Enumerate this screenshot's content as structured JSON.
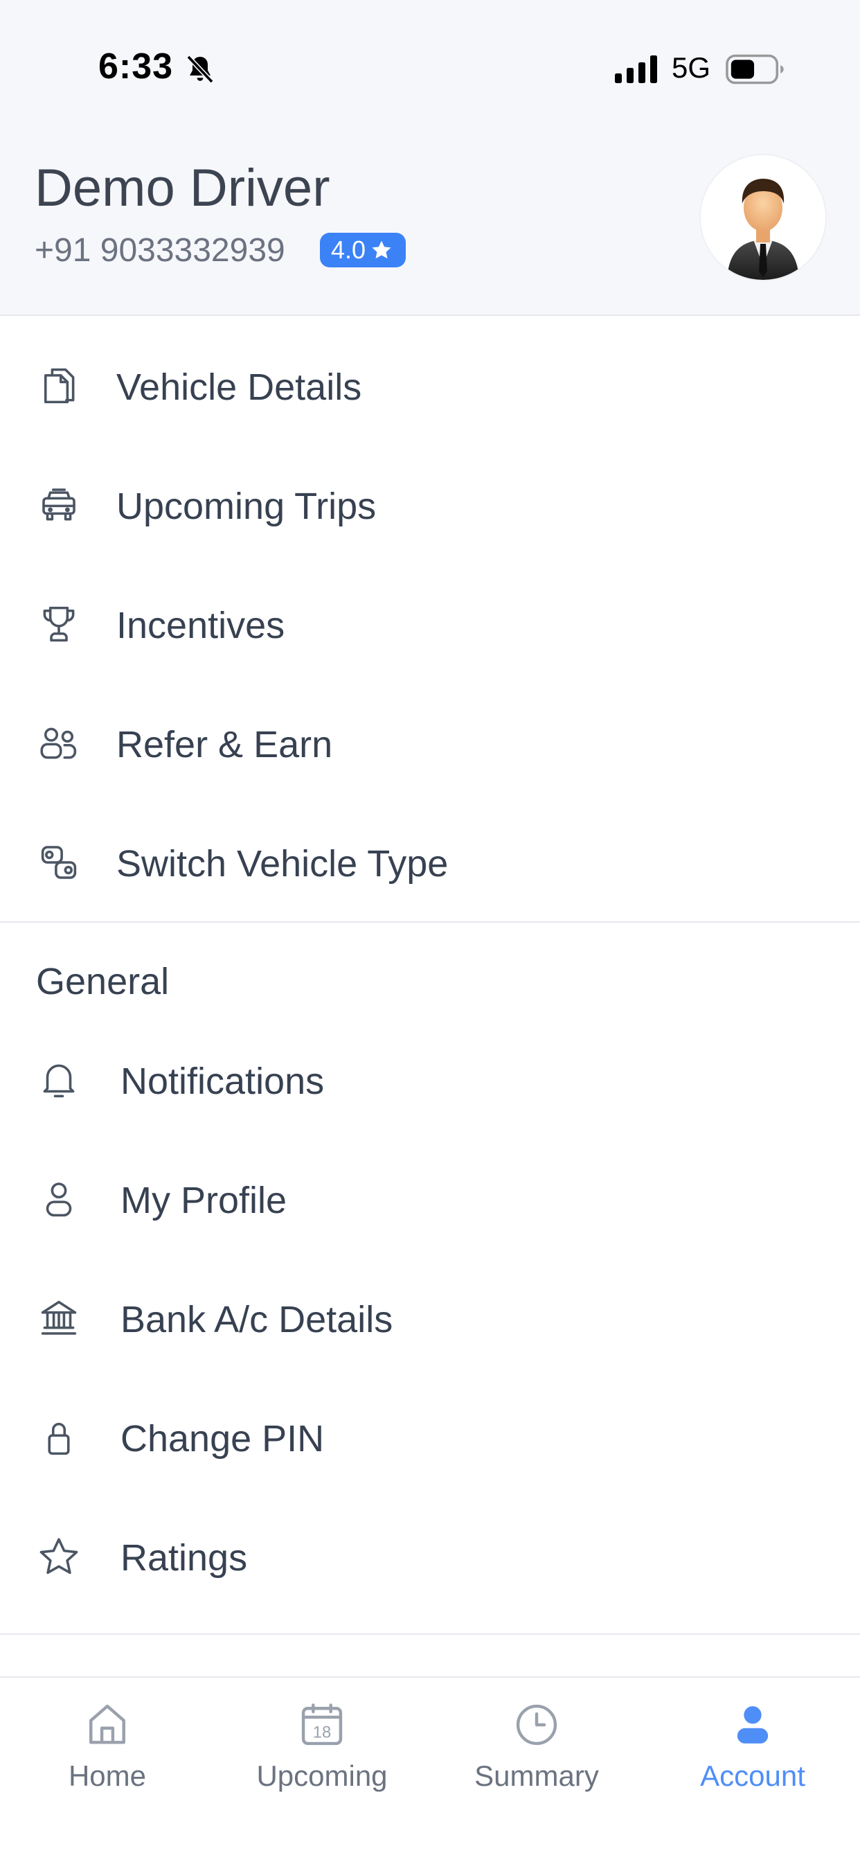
{
  "status_bar": {
    "time": "6:33",
    "network": "5G"
  },
  "profile": {
    "name": "Demo Driver",
    "phone": "+91 9033332939",
    "rating": "4.0"
  },
  "menu_primary": [
    {
      "label": "Vehicle Details",
      "icon": "document-icon"
    },
    {
      "label": "Upcoming Trips",
      "icon": "taxi-icon"
    },
    {
      "label": "Incentives",
      "icon": "trophy-icon"
    },
    {
      "label": "Refer & Earn",
      "icon": "users-icon"
    },
    {
      "label": "Switch Vehicle Type",
      "icon": "switch-icon"
    }
  ],
  "general": {
    "title": "General",
    "items": [
      {
        "label": "Notifications",
        "icon": "bell-icon"
      },
      {
        "label": "My Profile",
        "icon": "user-icon"
      },
      {
        "label": "Bank A/c Details",
        "icon": "bank-icon"
      },
      {
        "label": "Change PIN",
        "icon": "lock-icon"
      },
      {
        "label": "Ratings",
        "icon": "star-icon"
      }
    ]
  },
  "tabs": [
    {
      "label": "Home",
      "icon": "home-icon",
      "active": false
    },
    {
      "label": "Upcoming",
      "icon": "calendar-icon",
      "calendar_day": "18",
      "active": false
    },
    {
      "label": "Summary",
      "icon": "clock-icon",
      "active": false
    },
    {
      "label": "Account",
      "icon": "person-icon",
      "active": true
    }
  ],
  "colors": {
    "accent": "#3b82f6",
    "active_tab": "#4f8ef7",
    "text": "#374151",
    "header_bg": "#f6f7fb"
  }
}
